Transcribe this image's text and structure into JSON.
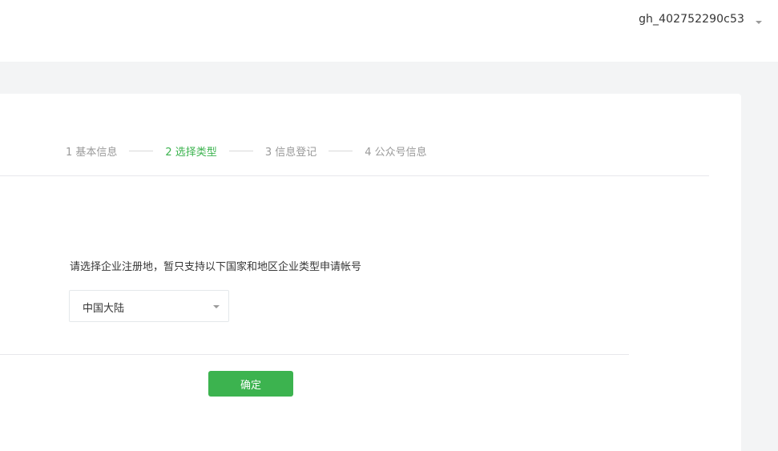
{
  "header": {
    "account_name": "gh_402752290c53"
  },
  "steps": [
    {
      "label": "1 基本信息",
      "state": "done"
    },
    {
      "label": "2 选择类型",
      "state": "active"
    },
    {
      "label": "3 信息登记",
      "state": "pending"
    },
    {
      "label": "4 公众号信息",
      "state": "pending"
    }
  ],
  "form": {
    "hint": "请选择企业注册地，暂只支持以下国家和地区企业类型申请帐号",
    "region_select": {
      "value": "中国大陆"
    },
    "confirm_label": "确定"
  },
  "colors": {
    "accent": "#3cb34f",
    "background": "#f3f4f5"
  }
}
